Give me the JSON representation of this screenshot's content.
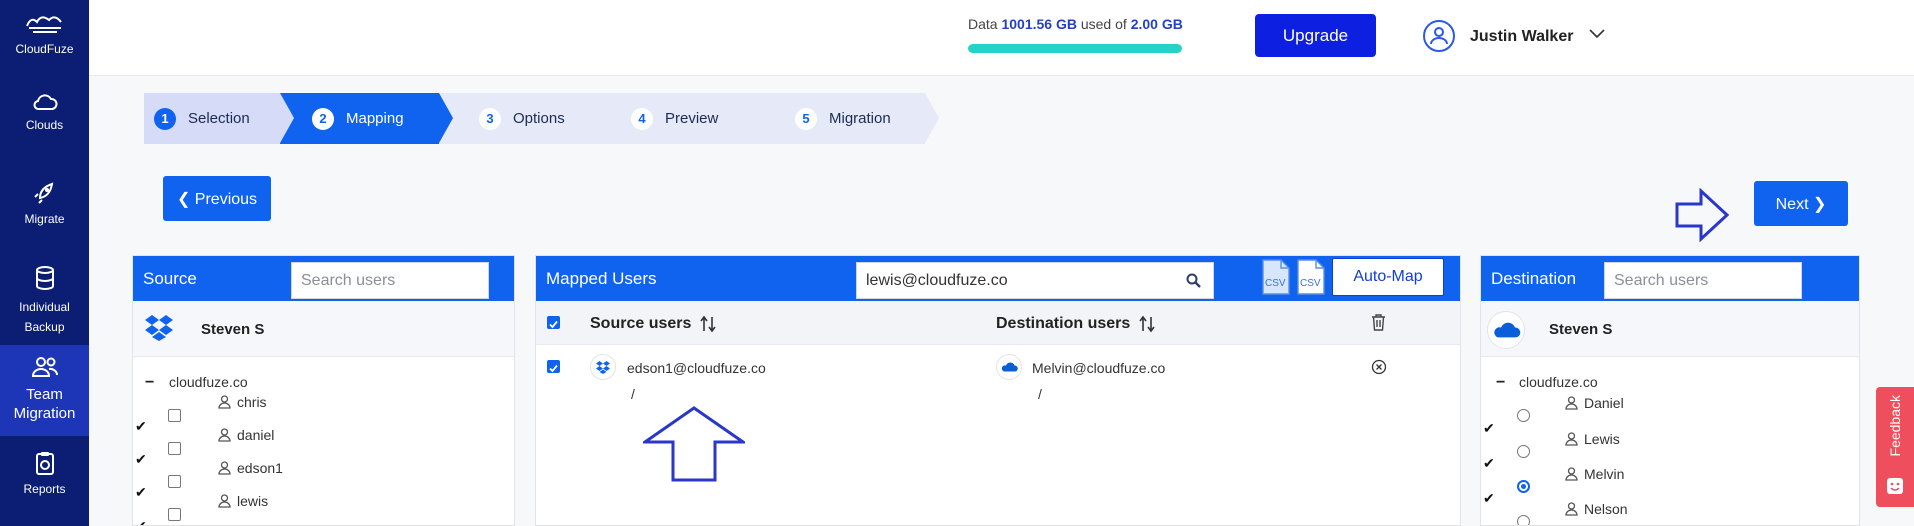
{
  "app": {
    "name": "CloudFuze"
  },
  "sidebar": {
    "items": [
      {
        "label": "Clouds",
        "icon": "cloud-icon"
      },
      {
        "label": "Migrate",
        "icon": "rocket-icon"
      },
      {
        "label": "Individual Backup",
        "icon": "database-icon"
      },
      {
        "label": "Team Migration",
        "icon": "users-icon"
      },
      {
        "label": "Reports",
        "icon": "reports-icon"
      }
    ]
  },
  "header": {
    "usage_prefix": "Data",
    "usage_used": "1001.56 GB",
    "usage_middle": "used of",
    "usage_total": "2.00 GB",
    "usage_fraction": 1.0,
    "upgrade_label": "Upgrade",
    "user_name": "Justin Walker"
  },
  "steps": [
    {
      "num": "1",
      "label": "Selection",
      "state": "done"
    },
    {
      "num": "2",
      "label": "Mapping",
      "state": "active"
    },
    {
      "num": "3",
      "label": "Options",
      "state": "todo"
    },
    {
      "num": "4",
      "label": "Preview",
      "state": "todo"
    },
    {
      "num": "5",
      "label": "Migration",
      "state": "todo"
    }
  ],
  "nav": {
    "previous_label": "Previous",
    "next_label": "Next"
  },
  "source": {
    "title": "Source",
    "search_placeholder": "Search users",
    "account": "Steven S",
    "domain": "cloudfuze.co",
    "users": [
      "chris",
      "daniel",
      "edson1",
      "lewis"
    ]
  },
  "mapped": {
    "title": "Mapped Users",
    "search_value": "lewis@cloudfuze.co",
    "automap_label": "Auto-Map",
    "col_source": "Source users",
    "col_destination": "Destination users",
    "rows": [
      {
        "source": "edson1@cloudfuze.co",
        "source_path": "/",
        "destination": "Melvin@cloudfuze.co",
        "destination_path": "/"
      }
    ]
  },
  "destination": {
    "title": "Destination",
    "search_placeholder": "Search users",
    "account": "Steven S",
    "domain": "cloudfuze.co",
    "users": [
      "Daniel",
      "Lewis",
      "Melvin",
      "Nelson"
    ]
  },
  "feedback": {
    "label": "Feedback"
  },
  "colors": {
    "primary": "#0f63ef",
    "sidebar": "#0b1e74",
    "upgrade": "#0d1fe0",
    "usage": "#23d3c3",
    "feedback": "#ef4e5d"
  }
}
